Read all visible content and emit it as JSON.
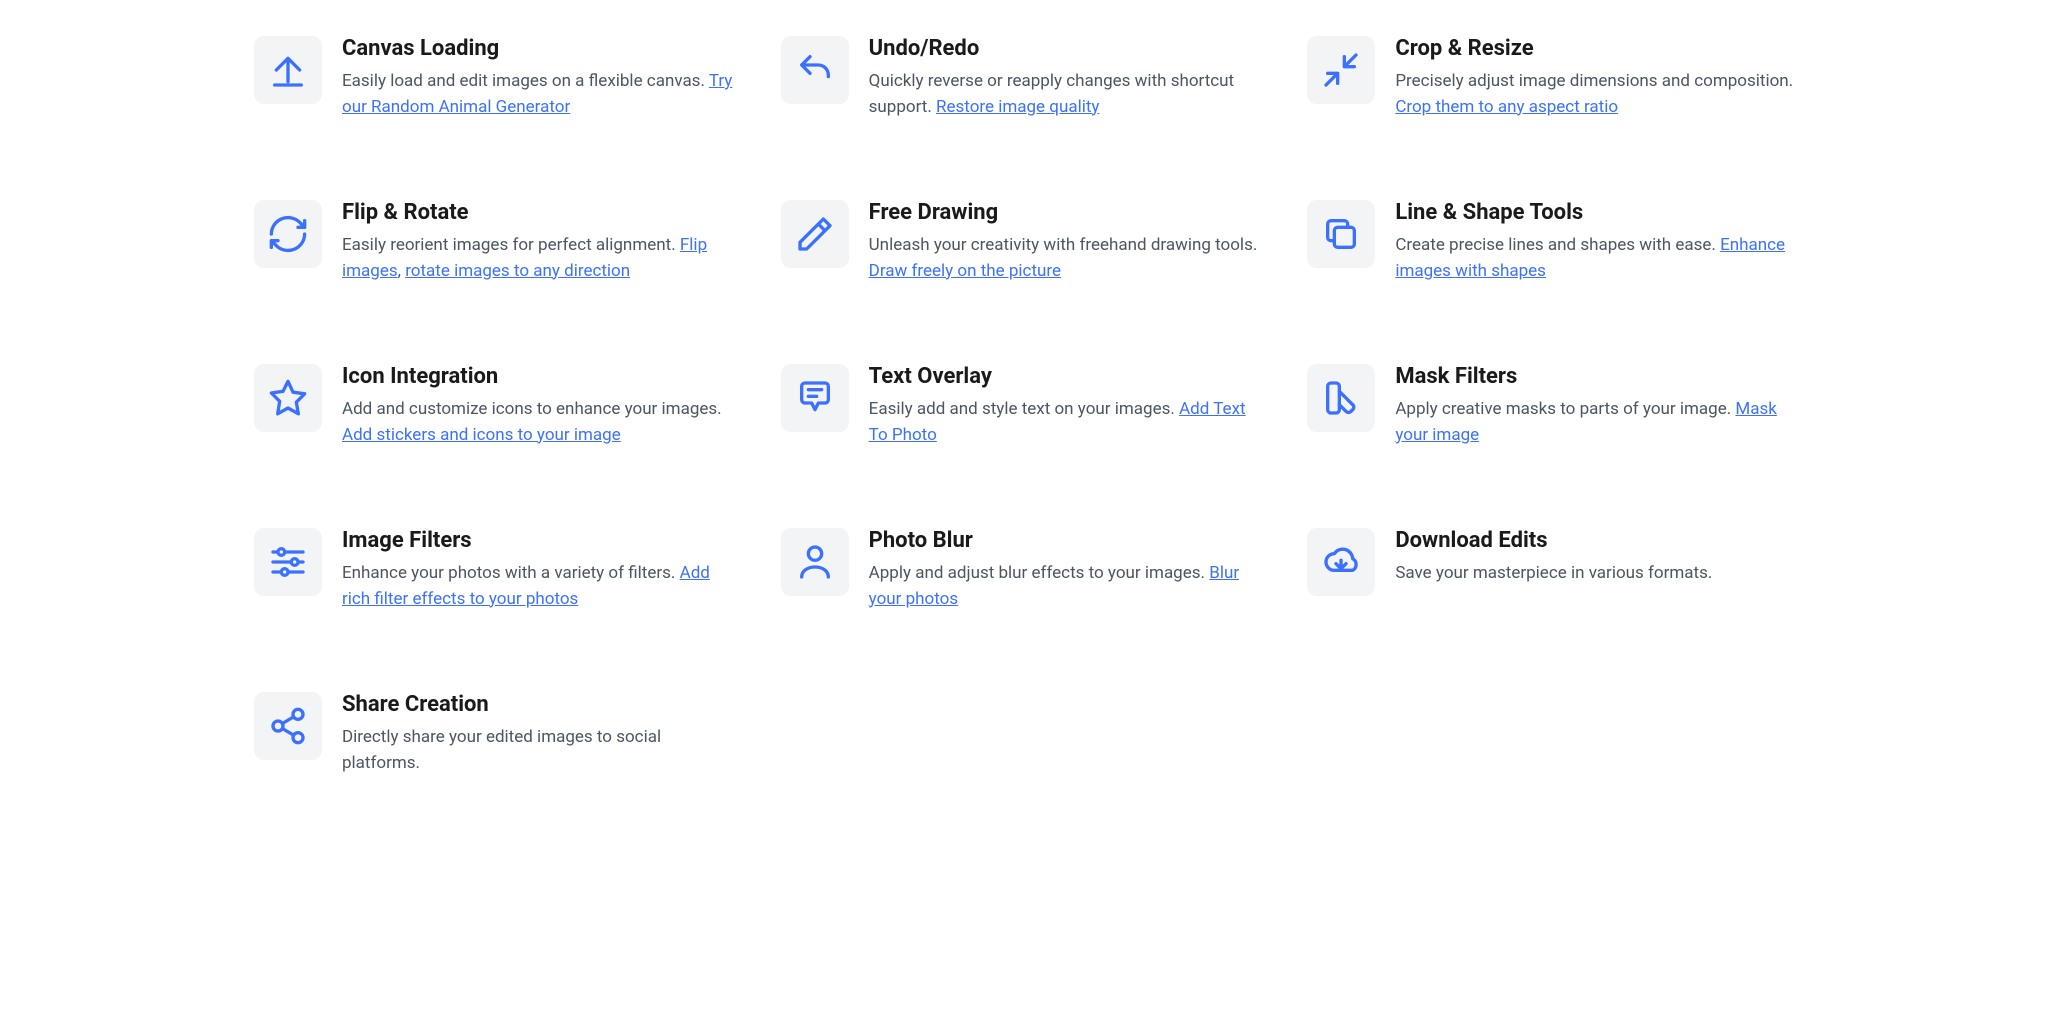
{
  "features": [
    {
      "title": "Canvas Loading",
      "desc": "Easily load and edit images on a flexible canvas.",
      "links": [
        {
          "text": "Try our Random Animal Generator"
        }
      ],
      "separator": " "
    },
    {
      "title": "Undo/Redo",
      "desc": "Quickly reverse or reapply changes with shortcut support.",
      "links": [
        {
          "text": "Restore image quality"
        }
      ],
      "separator": " "
    },
    {
      "title": "Crop & Resize",
      "desc": "Precisely adjust image dimensions and composition.",
      "links": [
        {
          "text": "Crop them to any aspect ratio"
        }
      ],
      "separator": " "
    },
    {
      "title": "Flip & Rotate",
      "desc": "Easily reorient images for perfect alignment.",
      "links": [
        {
          "text": "Flip images"
        },
        {
          "text": "rotate images to any direction"
        }
      ],
      "separator": ", ",
      "descSuffix": " "
    },
    {
      "title": "Free Drawing",
      "desc": "Unleash your creativity with freehand drawing tools.",
      "links": [
        {
          "text": "Draw freely on the picture"
        }
      ],
      "separator": " "
    },
    {
      "title": "Line & Shape Tools",
      "desc": "Create precise lines and shapes with ease.",
      "links": [
        {
          "text": "Enhance images with shapes"
        }
      ],
      "separator": " "
    },
    {
      "title": "Icon Integration",
      "desc": "Add and customize icons to enhance your images.",
      "links": [
        {
          "text": "Add stickers and icons to your image"
        }
      ],
      "separator": " "
    },
    {
      "title": "Text Overlay",
      "desc": "Easily add and style text on your images.",
      "links": [
        {
          "text": "Add Text To Photo"
        }
      ],
      "separator": " "
    },
    {
      "title": "Mask Filters",
      "desc": "Apply creative masks to parts of your image.",
      "links": [
        {
          "text": "Mask your image"
        }
      ],
      "separator": " "
    },
    {
      "title": "Image Filters",
      "desc": "Enhance your photos with a variety of filters.",
      "links": [
        {
          "text": "Add rich filter effects to your photos"
        }
      ],
      "separator": " "
    },
    {
      "title": "Photo Blur",
      "desc": "Apply and adjust blur effects to your images.",
      "links": [
        {
          "text": "Blur your photos"
        }
      ],
      "separator": " "
    },
    {
      "title": "Download Edits",
      "desc": "Save your masterpiece in various formats.",
      "links": [],
      "separator": ""
    },
    {
      "title": "Share Creation",
      "desc": "Directly share your edited images to social platforms.",
      "links": [],
      "separator": ""
    }
  ],
  "icons": [
    "upload",
    "undo",
    "crop-resize",
    "rotate",
    "pencil",
    "shapes",
    "star",
    "message",
    "swatch",
    "sliders",
    "user",
    "cloud-download",
    "share"
  ]
}
